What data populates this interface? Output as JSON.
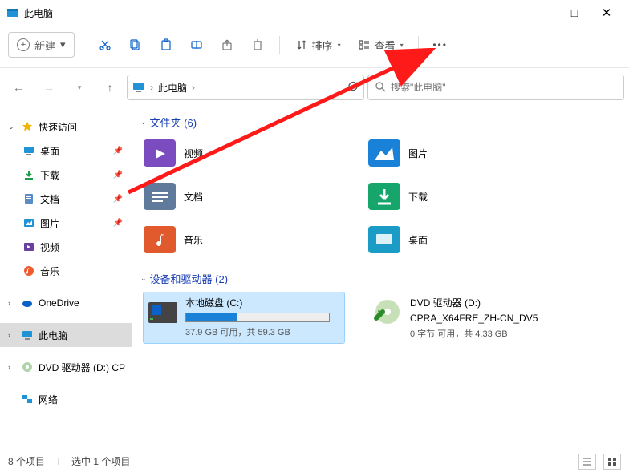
{
  "title": "此电脑",
  "win": {
    "min": "—",
    "max": "□",
    "close": "✕"
  },
  "toolbar": {
    "new_label": "新建",
    "sort_label": "排序",
    "view_label": "查看"
  },
  "address": {
    "root": "此电脑",
    "sep": "›"
  },
  "search": {
    "placeholder": "搜索\"此电脑\""
  },
  "sidebar": {
    "quick": "快速访问",
    "desktop": "桌面",
    "downloads": "下载",
    "documents": "文档",
    "pictures": "图片",
    "videos": "视频",
    "music": "音乐",
    "onedrive": "OneDrive",
    "thispc": "此电脑",
    "dvd": "DVD 驱动器 (D:) CP",
    "network": "网络"
  },
  "sections": {
    "folders": "文件夹 (6)",
    "drives": "设备和驱动器 (2)"
  },
  "folders": {
    "videos": "视频",
    "pictures": "图片",
    "documents": "文档",
    "downloads": "下载",
    "music": "音乐",
    "desktop": "桌面"
  },
  "drives_list": {
    "c": {
      "name": "本地磁盘 (C:)",
      "sub": "37.9 GB 可用，共 59.3 GB",
      "used_pct": 36
    },
    "d": {
      "name": "DVD 驱动器 (D:)",
      "label": "CPRA_X64FRE_ZH-CN_DV5",
      "sub": "0 字节 可用，共 4.33 GB"
    }
  },
  "status": {
    "items": "8 个项目",
    "selected": "选中 1 个项目"
  }
}
